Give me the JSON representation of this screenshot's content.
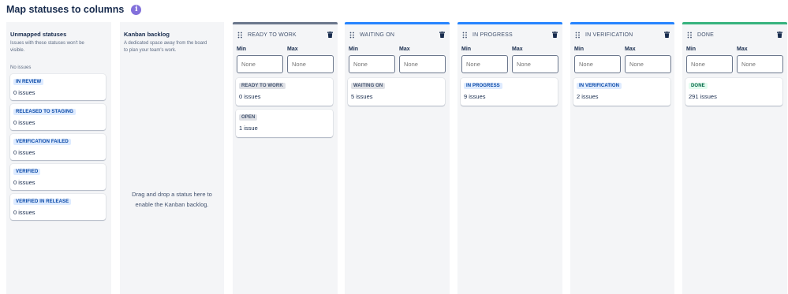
{
  "header": {
    "title": "Map statuses to columns",
    "info_icon": "info-icon"
  },
  "unmapped": {
    "title": "Unmapped statuses",
    "description": "Issues with these statuses won't be visible.",
    "empty_text": "No issues",
    "statuses": [
      {
        "name": "IN REVIEW",
        "count": "0 issues"
      },
      {
        "name": "RELEASED TO STAGING",
        "count": "0 issues"
      },
      {
        "name": "VERIFICATION FAILED",
        "count": "0 issues"
      },
      {
        "name": "VERIFIED",
        "count": "0 issues"
      },
      {
        "name": "VERIFIED IN RELEASE",
        "count": "0 issues"
      }
    ]
  },
  "backlog": {
    "title": "Kanban backlog",
    "description": "A dedicated space away from the board to plan your team's work.",
    "dropzone_text": "Drag and drop a status here to enable the Kanban backlog."
  },
  "labels": {
    "min": "Min",
    "max": "Max",
    "placeholder": "None"
  },
  "columns": [
    {
      "name": "READY TO WORK",
      "accent": "#6b778c",
      "statuses": [
        {
          "name": "READY TO WORK",
          "count": "0 issues",
          "category": "grey"
        },
        {
          "name": "OPEN",
          "count": "1 issue",
          "category": "grey"
        }
      ]
    },
    {
      "name": "WAITING ON",
      "accent": "#2684ff",
      "statuses": [
        {
          "name": "WAITING ON",
          "count": "5 issues",
          "category": "blue"
        }
      ]
    },
    {
      "name": "IN PROGRESS",
      "accent": "#2684ff",
      "statuses": [
        {
          "name": "IN PROGRESS",
          "count": "9 issues",
          "category": "blue"
        }
      ]
    },
    {
      "name": "IN VERIFICATION",
      "accent": "#2684ff",
      "statuses": [
        {
          "name": "IN VERIFICATION",
          "count": "2 issues",
          "category": "blue"
        }
      ]
    },
    {
      "name": "DONE",
      "accent": "#36b37e",
      "statuses": [
        {
          "name": "DONE",
          "count": "291 issues",
          "category": "green"
        }
      ]
    }
  ],
  "colors": {
    "blue_lozenge": "#0747a6",
    "green_lozenge": "#006644",
    "grey_lozenge": "#42526e",
    "column_bg": "#f4f5f7"
  }
}
